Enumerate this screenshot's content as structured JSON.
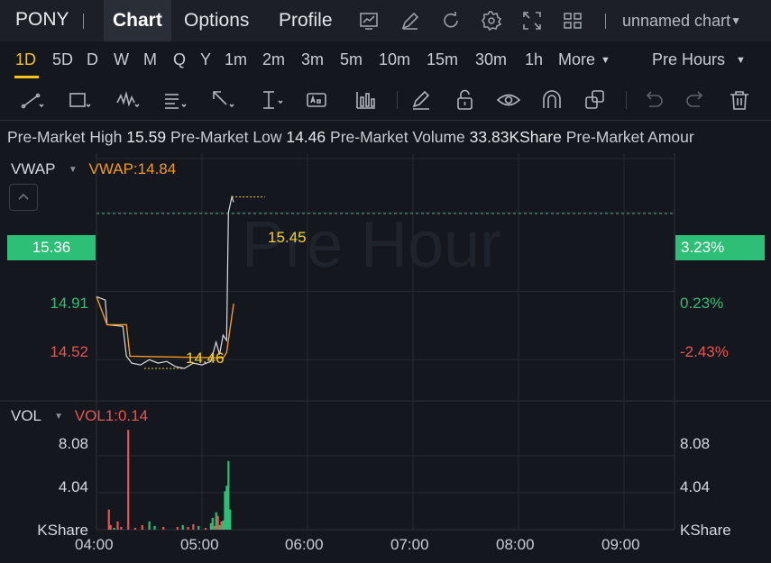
{
  "header": {
    "symbol": "PONY",
    "tabs": [
      "Chart",
      "Options",
      "Profile"
    ],
    "active_tab": "Chart",
    "chart_name": "unnamed chart",
    "icons": [
      "trend-icon",
      "edit-icon",
      "refresh-icon",
      "settings-icon",
      "fullscreen-icon",
      "layout-grid-icon"
    ]
  },
  "intervals": {
    "items": [
      "1D",
      "5D",
      "D",
      "W",
      "M",
      "Q",
      "Y",
      "1m",
      "2m",
      "3m",
      "5m",
      "10m",
      "15m",
      "30m",
      "1h",
      "More"
    ],
    "active": "1D",
    "session": "Pre Hours"
  },
  "tools": [
    "line-tool-icon",
    "rectangle-tool-icon",
    "pattern-tool-icon",
    "text-list-tool-icon",
    "arrow-tool-icon",
    "measure-tool-icon",
    "annotation-tool-icon",
    "indicator-tool-icon",
    "pencil-icon",
    "lock-icon",
    "eye-icon",
    "magnet-icon",
    "clone-icon",
    "undo-icon",
    "redo-icon",
    "trash-icon"
  ],
  "info": {
    "high_label": "Pre-Market High",
    "high_value": "15.59",
    "low_label": "Pre-Market Low",
    "low_value": "14.46",
    "volume_label": "Pre-Market Volume",
    "volume_value": "33.83KShare",
    "amount_label": "Pre-Market Amour"
  },
  "price_panel": {
    "indicator": "VWAP",
    "indicator_value": "VWAP:14.84",
    "watermark": "Pre Hour",
    "current_price": "15.36",
    "current_pct": "3.23%",
    "y_labels": [
      {
        "value": "14.91",
        "pct": "0.23%"
      },
      {
        "value": "14.52",
        "pct": "-2.43%"
      }
    ],
    "high_marker": "15.45",
    "low_marker": "14.46",
    "colors": {
      "up": "#2ebf77",
      "down": "#e8554e",
      "vwap": "#f29b1d",
      "marker": "#f5d020"
    }
  },
  "volume_panel": {
    "indicator": "VOL",
    "indicator_value": "VOL1:0.14",
    "y_labels": [
      "8.08",
      "4.04"
    ],
    "unit": "KShare"
  },
  "x_axis": [
    "04:00",
    "05:00",
    "06:00",
    "07:00",
    "08:00",
    "09:00"
  ],
  "chart_data": {
    "type": "line",
    "x_range": [
      "04:00",
      "09:30"
    ],
    "price_ylim": [
      14.3,
      15.7
    ],
    "price_series": [
      {
        "t": "04:00",
        "p": 14.88
      },
      {
        "t": "04:05",
        "p": 14.86
      },
      {
        "t": "04:06",
        "p": 14.72
      },
      {
        "t": "04:15",
        "p": 14.71
      },
      {
        "t": "04:17",
        "p": 14.54
      },
      {
        "t": "04:20",
        "p": 14.5
      },
      {
        "t": "04:25",
        "p": 14.49
      },
      {
        "t": "04:30",
        "p": 14.52
      },
      {
        "t": "04:35",
        "p": 14.5
      },
      {
        "t": "04:40",
        "p": 14.51
      },
      {
        "t": "04:45",
        "p": 14.48
      },
      {
        "t": "04:50",
        "p": 14.47
      },
      {
        "t": "04:55",
        "p": 14.5
      },
      {
        "t": "05:00",
        "p": 14.49
      },
      {
        "t": "05:05",
        "p": 14.51
      },
      {
        "t": "05:08",
        "p": 14.62
      },
      {
        "t": "05:10",
        "p": 14.55
      },
      {
        "t": "05:12",
        "p": 14.66
      },
      {
        "t": "05:14",
        "p": 14.63
      },
      {
        "t": "05:15",
        "p": 15.36
      },
      {
        "t": "05:17",
        "p": 15.45
      },
      {
        "t": "05:18",
        "p": 15.42
      }
    ],
    "vwap_series": [
      {
        "t": "04:00",
        "p": 14.88
      },
      {
        "t": "04:06",
        "p": 14.72
      },
      {
        "t": "04:17",
        "p": 14.72
      },
      {
        "t": "04:19",
        "p": 14.54
      },
      {
        "t": "05:12",
        "p": 14.53
      },
      {
        "t": "05:14",
        "p": 14.56
      },
      {
        "t": "05:18",
        "p": 14.84
      }
    ],
    "volume_ylim": [
      0,
      12
    ],
    "volume_bars": [
      {
        "t": "04:07",
        "v": 2.2,
        "dir": "down"
      },
      {
        "t": "04:08",
        "v": 0.5,
        "dir": "down"
      },
      {
        "t": "04:10",
        "v": 0.2,
        "dir": "up"
      },
      {
        "t": "04:12",
        "v": 0.9,
        "dir": "down"
      },
      {
        "t": "04:14",
        "v": 0.3,
        "dir": "down"
      },
      {
        "t": "04:18",
        "v": 10.9,
        "dir": "down"
      },
      {
        "t": "04:22",
        "v": 0.2,
        "dir": "down"
      },
      {
        "t": "04:26",
        "v": 0.5,
        "dir": "down"
      },
      {
        "t": "04:30",
        "v": 0.9,
        "dir": "up"
      },
      {
        "t": "04:33",
        "v": 0.4,
        "dir": "up"
      },
      {
        "t": "04:38",
        "v": 0.3,
        "dir": "down"
      },
      {
        "t": "04:46",
        "v": 0.3,
        "dir": "down"
      },
      {
        "t": "04:49",
        "v": 0.5,
        "dir": "up"
      },
      {
        "t": "04:52",
        "v": 0.3,
        "dir": "down"
      },
      {
        "t": "04:55",
        "v": 0.6,
        "dir": "down"
      },
      {
        "t": "04:58",
        "v": 0.4,
        "dir": "up"
      },
      {
        "t": "05:02",
        "v": 0.2,
        "dir": "down"
      },
      {
        "t": "05:05",
        "v": 0.7,
        "dir": "up"
      },
      {
        "t": "05:06",
        "v": 1.3,
        "dir": "up"
      },
      {
        "t": "05:07",
        "v": 0.4,
        "dir": "down"
      },
      {
        "t": "05:08",
        "v": 1.9,
        "dir": "up"
      },
      {
        "t": "05:09",
        "v": 1.5,
        "dir": "down"
      },
      {
        "t": "05:10",
        "v": 0.5,
        "dir": "up"
      },
      {
        "t": "05:11",
        "v": 0.9,
        "dir": "down"
      },
      {
        "t": "05:12",
        "v": 1.0,
        "dir": "up"
      },
      {
        "t": "05:13",
        "v": 4.2,
        "dir": "up"
      },
      {
        "t": "05:14",
        "v": 4.8,
        "dir": "up"
      },
      {
        "t": "05:15",
        "v": 7.5,
        "dir": "up"
      },
      {
        "t": "05:16",
        "v": 2.2,
        "dir": "up"
      }
    ]
  }
}
